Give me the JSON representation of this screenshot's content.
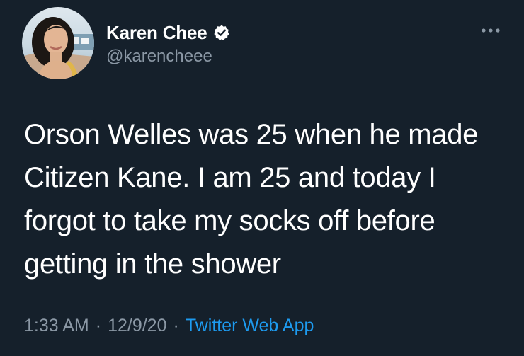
{
  "tweet": {
    "author": {
      "display_name": "Karen Chee",
      "handle": "@karencheee",
      "verified": true
    },
    "text": "Orson Welles was 25 when he made Citizen Kane. I am 25 and today I forgot to take my socks off before getting in the shower",
    "time": "1:33 AM",
    "date": "12/9/20",
    "separator": "·",
    "source": "Twitter Web App"
  },
  "icons": {
    "verified": "verified-badge-icon",
    "more": "more-options-icon"
  },
  "colors": {
    "background": "#15202b",
    "primary_text": "#ffffff",
    "secondary_text": "#8b98a5",
    "accent": "#1d9bf0"
  }
}
